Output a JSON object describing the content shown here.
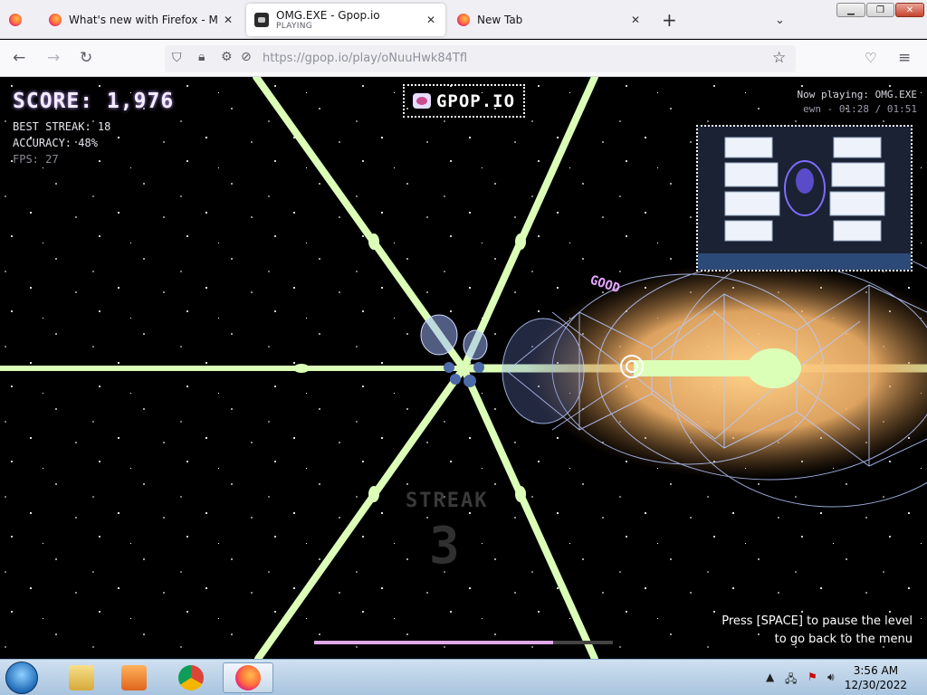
{
  "browser": {
    "tabs": [
      {
        "title": "What's new with Firefox - More"
      },
      {
        "title": "OMG.EXE - Gpop.io",
        "status": "PLAYING"
      },
      {
        "title": "New Tab"
      }
    ],
    "url": "https://gpop.io/play/oNuuHwk84Tfl",
    "colors": {
      "tabbar": "#f0f0f4",
      "accent": "#ff7139"
    }
  },
  "hud": {
    "score": "SCORE: 1,976",
    "best_streak": "BEST STREAK: 18",
    "accuracy": "ACCURACY: 48%",
    "fps": "FPS: 27",
    "logo": "GPOP.IO",
    "now_playing": "Now playing: OMG.EXE",
    "track_info": "ewn - 01:28 / 01:51",
    "good_label": "GOOD",
    "streak_label": "STREAK",
    "streak_value": "3",
    "hint_line1": "Press [SPACE] to pause the level",
    "hint_line2": "to go back to the menu",
    "progress": 0.8,
    "colors": {
      "lane": "#d8ffb0",
      "wire": "#a9c2ff",
      "glow": "#ffbf6b"
    }
  },
  "taskbar": {
    "time": "3:56 AM",
    "date": "12/30/2022",
    "apps": [
      "explorer-icon",
      "media-player-icon",
      "chrome-icon",
      "firefox-icon"
    ]
  }
}
